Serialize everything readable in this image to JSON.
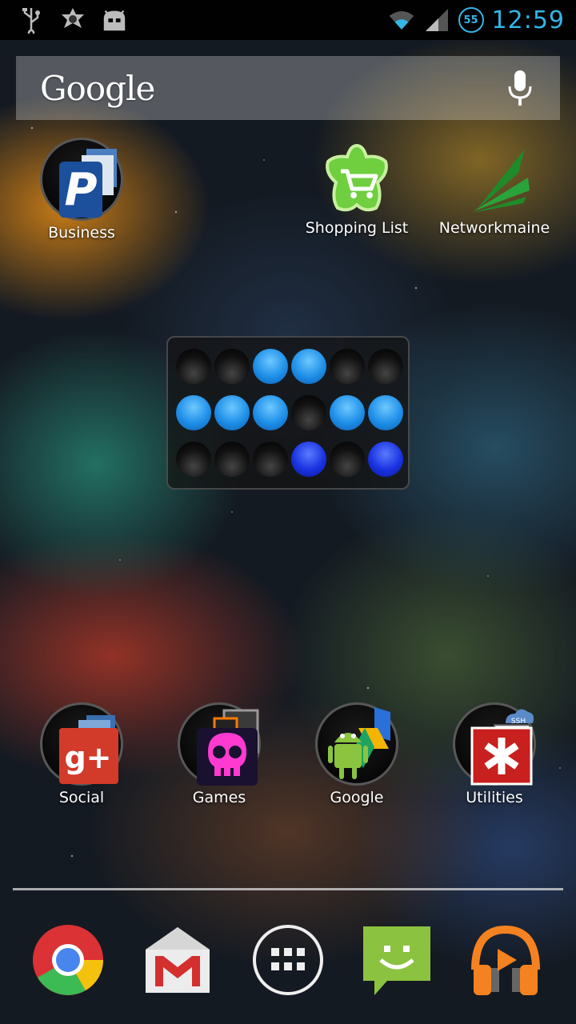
{
  "status_bar": {
    "left_icons": [
      "usb-icon",
      "badge-notification-icon",
      "android-debug-icon"
    ],
    "wifi": "wifi-icon",
    "signal": "cell-signal-icon",
    "battery_level": "55",
    "time": "12:59"
  },
  "search": {
    "logo_text": "Google",
    "mic_icon": "microphone-icon"
  },
  "top_apps": [
    {
      "label": "Business",
      "icon": "paypal-folder-icon"
    },
    {
      "label": "Shopping List",
      "icon": "shopping-cart-star-icon"
    },
    {
      "label": "Networkmaine",
      "icon": "networkmaine-logo-icon"
    }
  ],
  "binary_clock": {
    "rows": [
      [
        0,
        0,
        1,
        1,
        0,
        0
      ],
      [
        1,
        1,
        1,
        0,
        1,
        1
      ],
      [
        0,
        0,
        0,
        1,
        0,
        1
      ]
    ],
    "on_color": "#1e8fe8",
    "on_color_dark": "#1a32e0"
  },
  "folders": [
    {
      "label": "Social",
      "icon": "google-plus-folder-icon"
    },
    {
      "label": "Games",
      "icon": "games-folder-icon"
    },
    {
      "label": "Google",
      "icon": "google-apps-folder-icon"
    },
    {
      "label": "Utilities",
      "icon": "utilities-folder-icon"
    }
  ],
  "dock": [
    {
      "name": "chrome-icon"
    },
    {
      "name": "gmail-icon"
    },
    {
      "name": "app-drawer-icon"
    },
    {
      "name": "messaging-icon"
    },
    {
      "name": "play-music-icon"
    }
  ],
  "colors": {
    "status_accent": "#33b5e5"
  }
}
